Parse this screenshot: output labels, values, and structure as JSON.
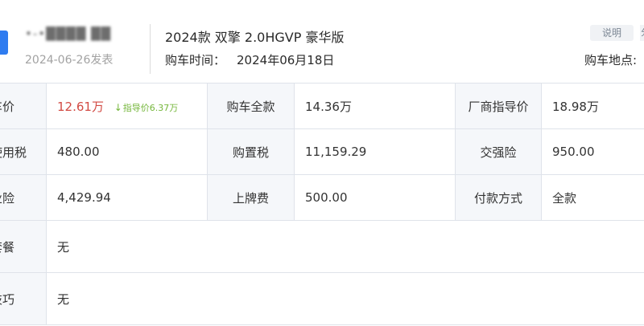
{
  "header": {
    "username": "•-•████ ██",
    "post_date": "2024-06-26发表",
    "car_model": "2024款 双擎 2.0HGVP 豪华版",
    "buy_time_label": "购车时间：",
    "buy_time_value": "2024年06月18日",
    "explain_button": "说明",
    "edge_box_text": "分",
    "buy_place_label": "购车地点:"
  },
  "table": {
    "row1": {
      "label1": "车价",
      "value1": "12.61万",
      "hint_arrow": "↓",
      "hint_text": "指导价6.37万",
      "label2": "购车全款",
      "value2": "14.36万",
      "label3": "厂商指导价",
      "value3": "18.98万"
    },
    "row2": {
      "label1": "使用税",
      "value1": "480.00",
      "label2": "购置税",
      "value2": "11,159.29",
      "label3": "交强险",
      "value3": "950.00"
    },
    "row3": {
      "label1": "业险",
      "value1": "4,429.94",
      "label2": "上牌费",
      "value2": "500.00",
      "label3": "付款方式",
      "value3": "全款"
    },
    "row4": {
      "label": "套餐",
      "value": "无"
    },
    "row5": {
      "label": "技巧",
      "value": "无"
    }
  },
  "colors": {
    "accent_red": "#d24a43",
    "hint_green": "#74b63a",
    "avatar_blue": "#2f7cf0",
    "label_bg": "#f5f7fa",
    "border": "#dfe3ea"
  }
}
